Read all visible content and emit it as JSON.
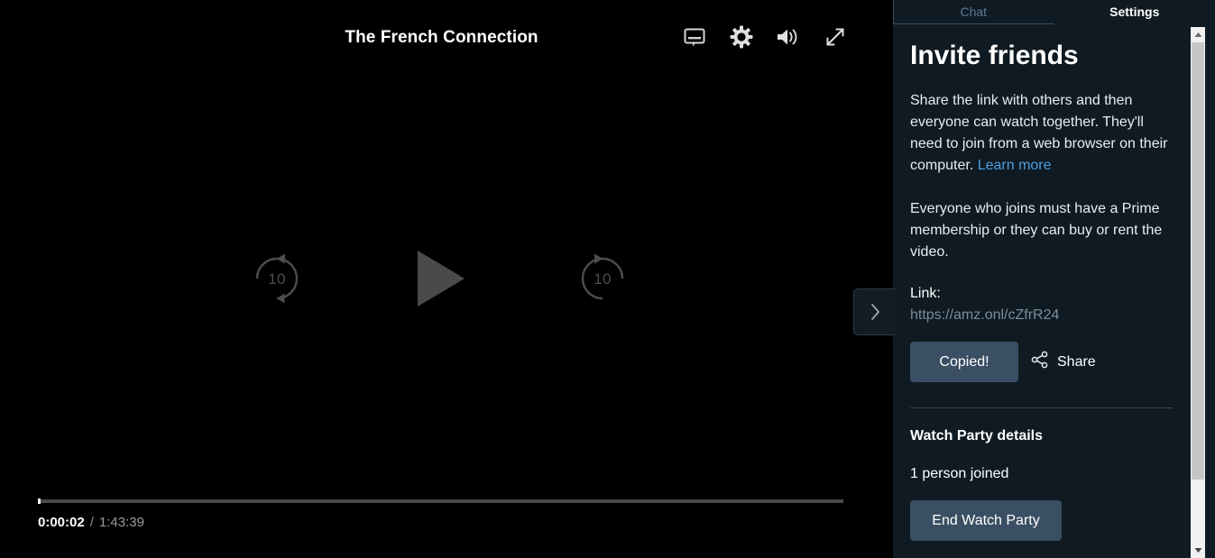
{
  "player": {
    "title": "The French Connection",
    "top_controls": [
      {
        "name": "subtitles-icon",
        "label": "Subtitles"
      },
      {
        "name": "gear-icon",
        "label": "Settings"
      },
      {
        "name": "volume-icon",
        "label": "Volume"
      },
      {
        "name": "fullscreen-icon",
        "label": "Fullscreen"
      }
    ],
    "rewind_seconds": "10",
    "forward_seconds": "10",
    "current_time": "0:00:02",
    "time_separator": "/",
    "total_time": "1:43:39",
    "progress_percent": 0.03,
    "toggle_icon": "chevron-right-icon"
  },
  "panel": {
    "tabs": [
      {
        "label": "Chat",
        "active": false
      },
      {
        "label": "Settings",
        "active": true
      }
    ],
    "heading": "Invite friends",
    "paragraph1_before_link": "Share the link with others and then everyone can watch together. They'll need to join from a web browser on their computer. ",
    "paragraph1_link": "Learn more",
    "paragraph2": "Everyone who joins must have a Prime membership or they can buy or rent the video.",
    "link_label": "Link:",
    "link_url": "https://amz.onl/cZfrR24",
    "copy_button": "Copied!",
    "share_button": "Share",
    "details_heading": "Watch Party details",
    "joined_status": "1 person joined",
    "end_button": "End Watch Party"
  },
  "colors": {
    "panel_background": "#0f1a22",
    "player_background": "#000000",
    "button_slate": "#3a4f63",
    "link_blue": "#4a9ee0",
    "url_gray": "#7b8d9b",
    "tab_inactive": "#5f7d96",
    "divider": "#37495a",
    "scrollbar_track": "#f1f1f1",
    "scrollbar_thumb": "#c6c6c6"
  }
}
